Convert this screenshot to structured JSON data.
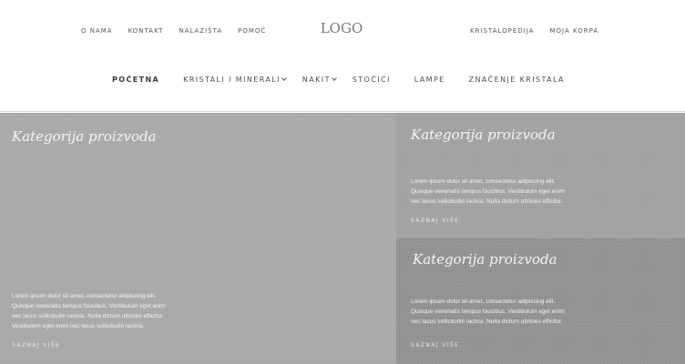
{
  "header": {
    "top_nav_left": [
      "O NAMA",
      "KONTAKT",
      "NALAZIŠTA",
      "POMOĆ"
    ],
    "logo": "LOGO",
    "top_nav_right": [
      "KRISTALOPEDIJA",
      "MOJA KORPA"
    ],
    "main_nav": [
      {
        "label": "POČETNA",
        "active": true,
        "dropdown": false
      },
      {
        "label": "KRISTALI I MINERALI",
        "active": false,
        "dropdown": true
      },
      {
        "label": "NAKIT",
        "active": false,
        "dropdown": true
      },
      {
        "label": "STOČIĆI",
        "active": false,
        "dropdown": false
      },
      {
        "label": "LAMPE",
        "active": false,
        "dropdown": false
      },
      {
        "label": "ZNAČENJE KRISTALA",
        "active": false,
        "dropdown": false
      }
    ]
  },
  "tiles": [
    {
      "title": "Kategorija proizvoda",
      "text_lines": [
        "Lorem ipsum dolor sit amet, consectetur adipiscing elit.",
        "Quisque venenatis tempus faucibus. Vestibulum eget enim",
        "nec lacus sollicitudin lacinia. Nulla dictum ultricies efficitur.",
        "Vestibulum eget enim nec lacus sollicitudin lacinia."
      ],
      "link": "SAZNAJ VIŠE",
      "color": "#a9a9a9"
    },
    {
      "title": "Kategorija proizvoda",
      "text_lines": [
        "Lorem ipsum dolor sit amet, consectetur adipiscing elit.",
        "Quisque venenatis tempus faucibus. Vestibulum eget enim",
        "nec lacus sollicitudin lacinia. Nulla dictum ultricies efficitur."
      ],
      "link": "SAZNAJ VIŠE",
      "color": "#a2a2a2"
    },
    {
      "title": "Kategorija proizvoda",
      "text_lines": [
        "Lorem ipsum dolor sit amet, consectetur adipiscing elit.",
        "Quisque venenatis tempus faucibus. Vestibulum eget enim",
        "nec lacus sollicitudin lacinia. Nulla dictum ultricies efficitur."
      ],
      "link": "SAZNAJ VIŠE",
      "color": "#929292"
    }
  ]
}
